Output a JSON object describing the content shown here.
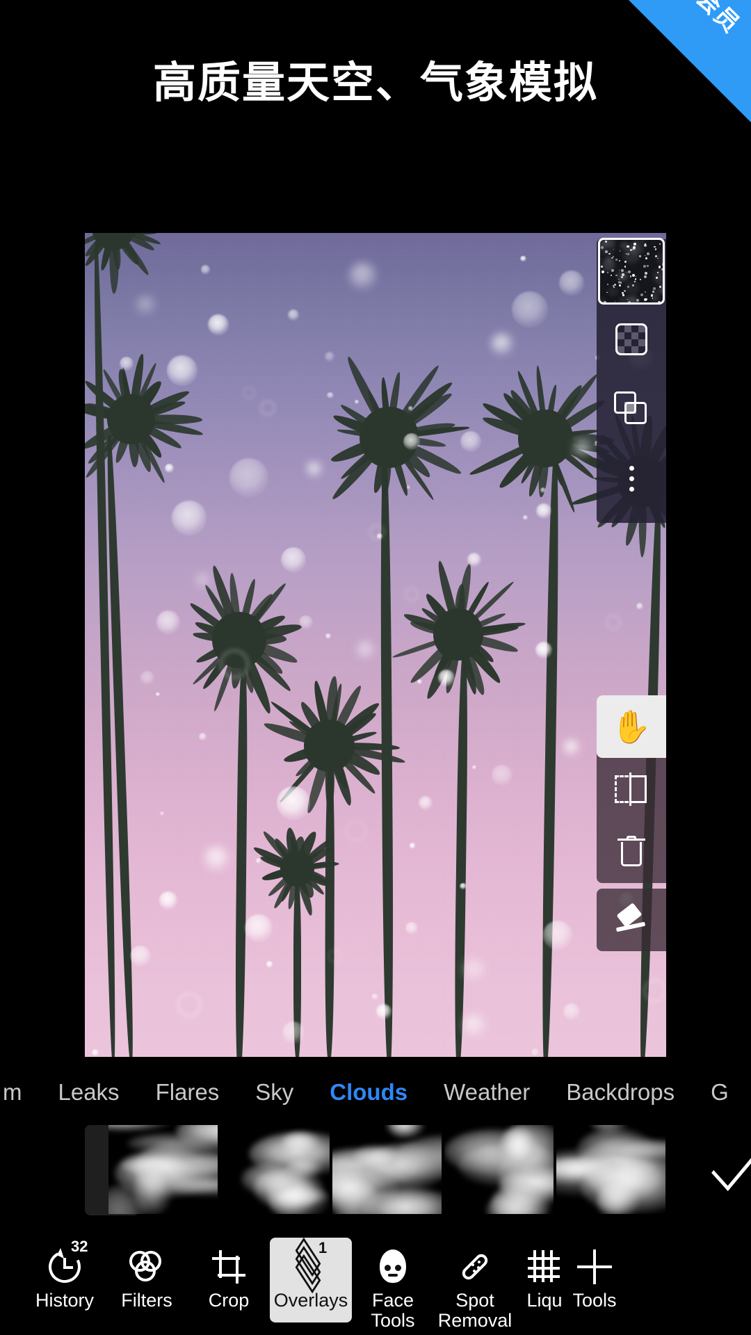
{
  "ribbon": {
    "label": "会员"
  },
  "header": {
    "title": "高质量天空、气象模拟"
  },
  "layers_panel": {
    "thumbnail_name": "layer-thumbnail",
    "opacity_label": "opacity-checkerboard",
    "blend_label": "blend-mode",
    "more_label": "more-options"
  },
  "tool_rail": {
    "pan_label": "pan-hand",
    "flip_label": "flip-horizontal",
    "delete_label": "delete-layer",
    "erase_label": "eraser"
  },
  "category_tabs": {
    "items": [
      {
        "label": "m",
        "active": false
      },
      {
        "label": "Leaks",
        "active": false
      },
      {
        "label": "Flares",
        "active": false
      },
      {
        "label": "Sky",
        "active": false
      },
      {
        "label": "Clouds",
        "active": true
      },
      {
        "label": "Weather",
        "active": false
      },
      {
        "label": "Backdrops",
        "active": false
      },
      {
        "label": "G",
        "active": false
      }
    ],
    "active_label": "Clouds",
    "active_color": "#2f87f6"
  },
  "overlay_strip": {
    "more_label": "more-overlays",
    "confirm_label": "apply-overlay",
    "thumbnails": [
      {
        "name": "cloud-overlay-1"
      },
      {
        "name": "cloud-overlay-2"
      },
      {
        "name": "cloud-overlay-3"
      },
      {
        "name": "cloud-overlay-4"
      },
      {
        "name": "cloud-overlay-5"
      }
    ]
  },
  "bottom_bar": {
    "items": [
      {
        "label": "History",
        "badge": "32",
        "selected": false
      },
      {
        "label": "Filters",
        "badge": "",
        "selected": false
      },
      {
        "label": "Crop",
        "badge": "",
        "selected": false
      },
      {
        "label": "Overlays",
        "badge": "1",
        "selected": true
      },
      {
        "label": "Face\nTools",
        "badge": "",
        "selected": false
      },
      {
        "label": "Spot\nRemoval",
        "badge": "",
        "selected": false
      },
      {
        "label": "Liqu",
        "badge": "",
        "selected": false
      },
      {
        "label": "Tools",
        "badge": "",
        "selected": false
      }
    ]
  },
  "colors": {
    "background": "#000000",
    "ribbon_blue": "#2f9bf6",
    "accent_blue": "#2f87f6",
    "selected_chip": "#e2e2e2",
    "sky_top": "#6f6a9a",
    "sky_bottom": "#ecc5dc",
    "palm": "#2b372d"
  },
  "canvas": {
    "name": "photo-editing-canvas",
    "subject": "palm-trees-sunset-sky-with-bokeh-overlay"
  }
}
